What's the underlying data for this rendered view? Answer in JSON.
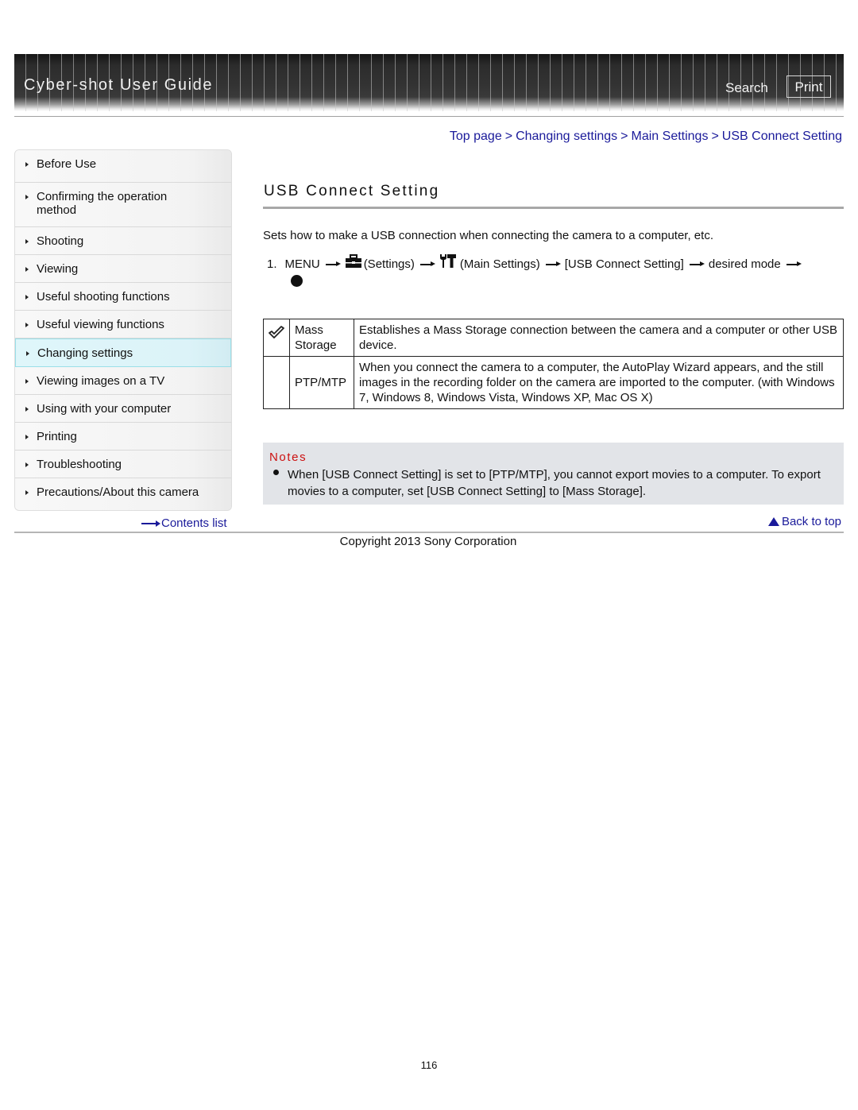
{
  "header": {
    "title": "Cyber-shot User Guide",
    "search_label": "Search",
    "print_label": "Print"
  },
  "breadcrumb": [
    {
      "label": "Top page"
    },
    {
      "label": "Changing settings"
    },
    {
      "label": "Main Settings"
    },
    {
      "label": "USB Connect Setting"
    }
  ],
  "breadcrumb_separator": ">",
  "sidebar": {
    "items": [
      {
        "label": "Before Use"
      },
      {
        "label": "Confirming the operation method"
      },
      {
        "label": "Shooting"
      },
      {
        "label": "Viewing"
      },
      {
        "label": "Useful shooting functions"
      },
      {
        "label": "Useful viewing functions"
      },
      {
        "label": "Changing settings",
        "active": true
      },
      {
        "label": "Viewing images on a TV"
      },
      {
        "label": "Using with your computer"
      },
      {
        "label": "Printing"
      },
      {
        "label": "Troubleshooting"
      },
      {
        "label": "Precautions/About this camera"
      }
    ],
    "contents_link": "Contents list"
  },
  "main": {
    "title": "USB Connect Setting",
    "intro": "Sets how to make a USB connection when connecting the camera to a computer, etc.",
    "step": {
      "number": "1.",
      "menu": "MENU",
      "settings_icon": "settings-toolbox-icon",
      "settings": "(Settings)",
      "main_settings_icon": "main-settings-wrench-icon",
      "main_settings": "(Main Settings)",
      "usb": "[USB Connect Setting]",
      "desired": "desired mode",
      "end_icon": "center-button-dot-icon"
    },
    "table": {
      "rows": [
        {
          "icon": "check-icon",
          "name": "Mass Storage",
          "description": "Establishes a Mass Storage connection between the camera and a computer or other USB device."
        },
        {
          "icon": "",
          "name": "PTP/MTP",
          "description": "When you connect the camera to a computer, the AutoPlay Wizard appears, and the still images in the recording folder on the camera are imported to the computer. (with Windows 7, Windows 8, Windows Vista, Windows XP, Mac OS X)"
        }
      ]
    },
    "notes": {
      "heading": "Notes",
      "items": [
        "When [USB Connect Setting] is set to [PTP/MTP], you cannot export movies to a computer. To export movies to a computer, set [USB Connect Setting] to [Mass Storage]."
      ]
    },
    "back_to_top": "Back to top"
  },
  "footer": {
    "copyright": "Copyright 2013 Sony Corporation",
    "page_number": "116"
  },
  "colors": {
    "link": "#1a1a9a",
    "notes_heading": "#cc1111",
    "notes_bg": "#e2e4e8",
    "active_nav_bg": "#dff6fa"
  }
}
